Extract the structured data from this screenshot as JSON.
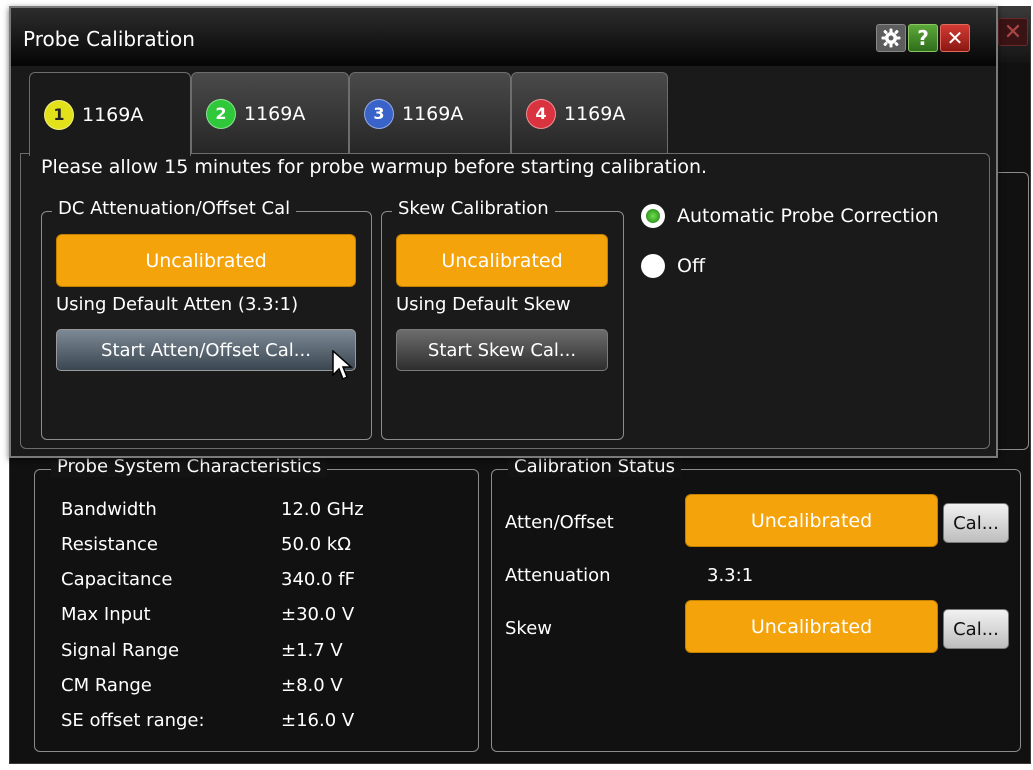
{
  "front": {
    "title": "Probe Calibration",
    "tabs": [
      {
        "number": "1",
        "label": "1169A",
        "color": "#e3e119"
      },
      {
        "number": "2",
        "label": "1169A",
        "color": "#2fc83a"
      },
      {
        "number": "3",
        "label": "1169A",
        "color": "#3a63c9"
      },
      {
        "number": "4",
        "label": "1169A",
        "color": "#d9333f"
      }
    ],
    "warmup_text": "Please allow 15 minutes for probe warmup before starting calibration.",
    "dc_group": {
      "title": "DC Attenuation/Offset Cal",
      "status": "Uncalibrated",
      "info": "Using Default Atten (3.3:1)",
      "button": "Start Atten/Offset Cal..."
    },
    "skew_group": {
      "title": "Skew Calibration",
      "status": "Uncalibrated",
      "info": "Using Default Skew",
      "button": "Start Skew Cal..."
    },
    "radios": {
      "auto": "Automatic Probe Correction",
      "off": "Off"
    }
  },
  "back": {
    "probe_system": {
      "title": "Probe System Characteristics",
      "rows": [
        {
          "label": "Bandwidth",
          "value": "12.0 GHz"
        },
        {
          "label": "Resistance",
          "value": "50.0 kΩ"
        },
        {
          "label": "Capacitance",
          "value": "340.0 fF"
        },
        {
          "label": "Max Input",
          "value": "±30.0 V"
        },
        {
          "label": "Signal Range",
          "value": "±1.7 V"
        },
        {
          "label": "CM Range",
          "value": "±8.0 V"
        },
        {
          "label": "SE offset range:",
          "value": "±16.0 V"
        }
      ]
    },
    "cal_status": {
      "title": "Calibration Status",
      "atten_label": "Atten/Offset",
      "atten_status": "Uncalibrated",
      "atten_button": "Cal...",
      "attenuation_label": "Attenuation",
      "attenuation_value": "3.3:1",
      "skew_label": "Skew",
      "skew_status": "Uncalibrated",
      "skew_button": "Cal..."
    },
    "close_icon": "x-icon"
  }
}
